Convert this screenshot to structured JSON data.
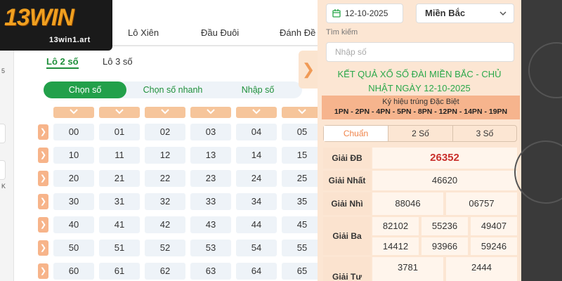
{
  "logo": {
    "main": "13WIN",
    "domain": "13win1.art"
  },
  "left_strip": {
    "text1": "5",
    "text2": "K"
  },
  "tabs": [
    {
      "label": "Lô Xiên"
    },
    {
      "label": "Đầu Đuôi"
    },
    {
      "label": "Đánh Đề"
    }
  ],
  "subtabs": [
    {
      "label": "Lô 2 số",
      "active": true
    },
    {
      "label": "Lô 3 số",
      "active": false
    }
  ],
  "modes": [
    {
      "label": "Chọn số",
      "active": true
    },
    {
      "label": "Chọn số nhanh",
      "active": false
    },
    {
      "label": "Nhập số",
      "active": false
    }
  ],
  "number_grid": [
    [
      "00",
      "01",
      "02",
      "03",
      "04",
      "05"
    ],
    [
      "10",
      "11",
      "12",
      "13",
      "14",
      "15"
    ],
    [
      "20",
      "21",
      "22",
      "23",
      "24",
      "25"
    ],
    [
      "30",
      "31",
      "32",
      "33",
      "34",
      "35"
    ],
    [
      "40",
      "41",
      "42",
      "43",
      "44",
      "45"
    ],
    [
      "50",
      "51",
      "52",
      "53",
      "54",
      "55"
    ],
    [
      "60",
      "61",
      "62",
      "63",
      "64",
      "65"
    ]
  ],
  "filters": {
    "date": "12-10-2025",
    "region": "Miền Bắc",
    "search_label": "Tìm kiếm",
    "search_placeholder": "Nhập số"
  },
  "result": {
    "title_line1": "KẾT QUẢ XỔ SỐ ĐÀI MIỀN BẮC - CHỦ",
    "title_line2": "NHẬT NGÀY 12-10-2025",
    "special_symbol_label": "Ký hiệu trúng Đặc Biệt",
    "special_symbols": "1PN - 2PN - 4PN - 5PN - 8PN - 12PN - 14PN - 19PN",
    "view_modes": [
      {
        "label": "Chuẩn",
        "active": true
      },
      {
        "label": "2 Số",
        "active": false
      },
      {
        "label": "3 Số",
        "active": false
      }
    ],
    "prizes": {
      "db": {
        "label": "Giải ĐB",
        "values": [
          "26352"
        ]
      },
      "nhat": {
        "label": "Giải Nhất",
        "values": [
          "46620"
        ]
      },
      "nhi": {
        "label": "Giải Nhì",
        "values": [
          "88046",
          "06757"
        ]
      },
      "ba": {
        "label": "Giải Ba",
        "values": [
          "82102",
          "55236",
          "49407",
          "14412",
          "93966",
          "59246"
        ]
      },
      "tu": {
        "label": "Giải Tư",
        "values": [
          "3781",
          "2444"
        ]
      }
    }
  },
  "colors": {
    "brand_green": "#22a04a",
    "accent_orange": "#f09a56",
    "special_red": "#c9302c",
    "panel_peach": "#fce6d3"
  }
}
